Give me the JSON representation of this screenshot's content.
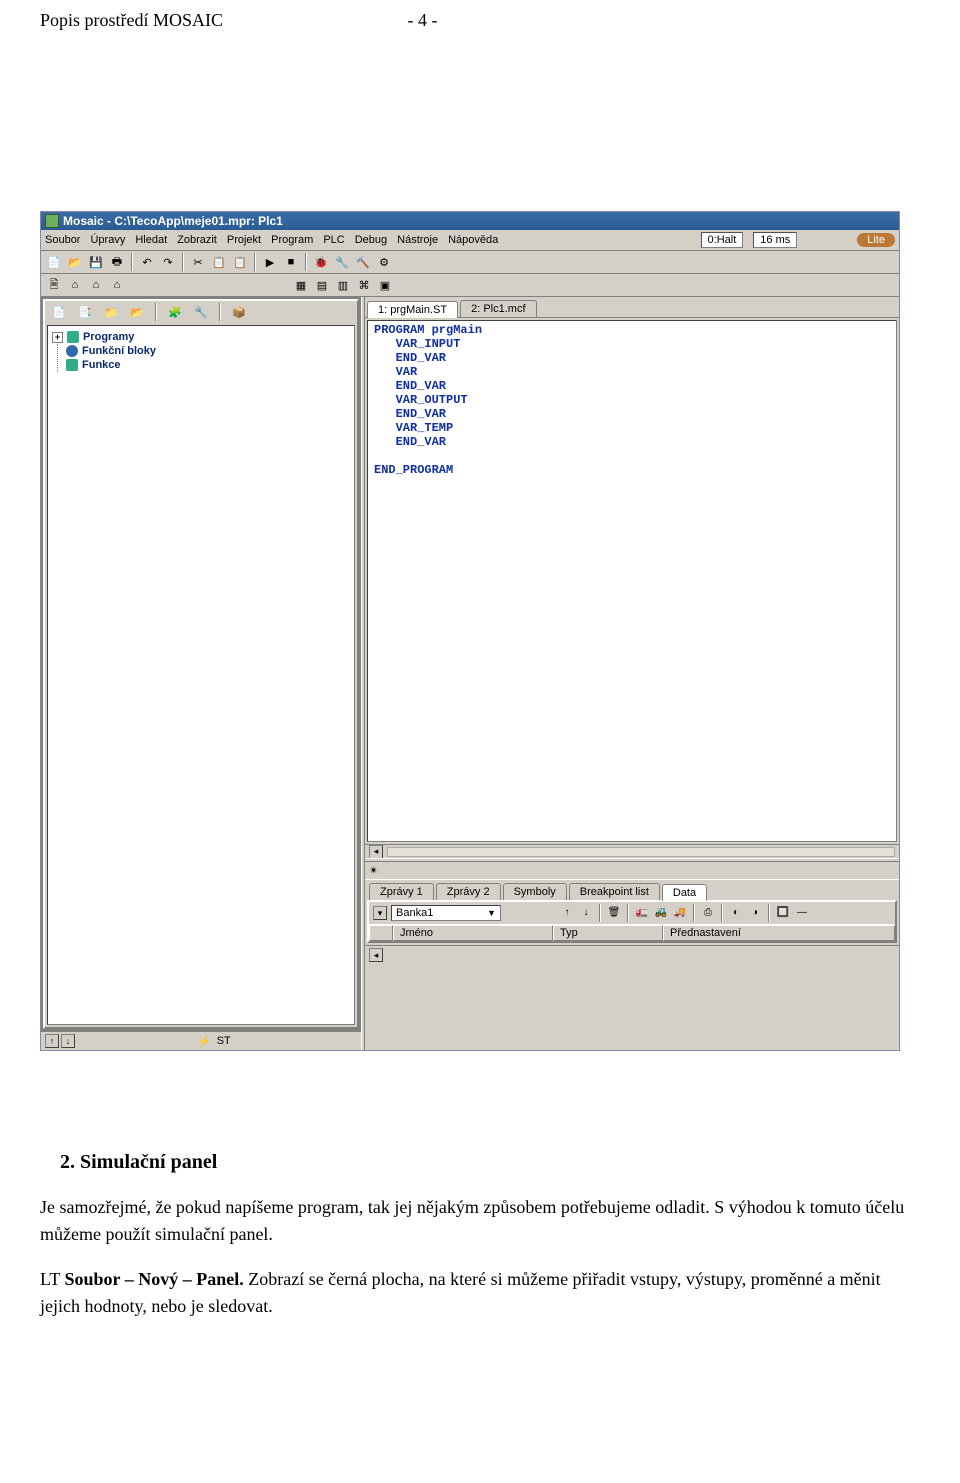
{
  "doc": {
    "header_left": "Popis prostředí MOSAIC",
    "header_right": "- 4 -",
    "heading": "2.  Simulační panel",
    "para1": "Je samozřejmé, že pokud napíšeme program, tak jej nějakým způsobem potřebujeme odladit. S výhodou k tomuto účelu můžeme použít simulační panel.",
    "para2_prefix": "LT ",
    "para2_bold": "Soubor – Nový – Panel.",
    "para2_rest": " Zobrazí se černá plocha, na které si můžeme přiřadit vstupy, výstupy, proměnné a měnit jejich hodnoty, nebo je sledovat."
  },
  "app": {
    "title": "Mosaic - C:\\TecoApp\\meje01.mpr: Plc1",
    "menu": [
      "Soubor",
      "Úpravy",
      "Hledat",
      "Zobrazit",
      "Projekt",
      "Program",
      "PLC",
      "Debug",
      "Nástroje",
      "Nápověda"
    ],
    "status1": "0:Halt",
    "status2": "16 ms",
    "status3": "Lite",
    "toolbar1": [
      "📄",
      "📂",
      "💾",
      "🖶",
      "",
      "↶",
      "↷",
      "",
      "✂",
      "📋",
      "📋",
      "",
      "▶",
      "■",
      "",
      "🐞",
      "🔧",
      "🔨",
      "⚙"
    ],
    "toolbar2_left": [
      "🗎",
      "⌂",
      "⌂",
      "⌂"
    ],
    "toolbar2_right": [
      "▦",
      "▤",
      "▥",
      "⌘",
      "▣"
    ],
    "tree_toolbar": [
      "📄",
      "📑",
      "📁",
      "📂",
      "",
      "🧩",
      "🔧",
      "",
      "📦"
    ],
    "tree": {
      "items": [
        {
          "expander": "+",
          "icon": "green",
          "label": "Programy"
        },
        {
          "expander": "",
          "icon": "blue",
          "label": "Funkční bloky",
          "indent": 1
        },
        {
          "expander": "",
          "icon": "green",
          "label": "Funkce",
          "indent": 1
        }
      ]
    },
    "left_bottom_label": "ST",
    "editor_tabs": [
      "1: prgMain.ST",
      "2: Plc1.mcf"
    ],
    "editor_active_tab": 0,
    "code_lines": [
      "PROGRAM prgMain",
      "   VAR_INPUT",
      "   END_VAR",
      "   VAR",
      "   END_VAR",
      "   VAR_OUTPUT",
      "   END_VAR",
      "   VAR_TEMP",
      "   END_VAR",
      "",
      "END_PROGRAM"
    ],
    "bottom_tabs": [
      "Zprávy 1",
      "Zprávy 2",
      "Symboly",
      "Breakpoint list",
      "Data"
    ],
    "bottom_active_tab": 4,
    "bottom_combo": "Banka1",
    "bottom_icons": [
      "↑",
      "↓",
      "",
      "🗑",
      "",
      "🚛",
      "🚜",
      "🚚",
      "",
      "⎙",
      "",
      "◐",
      "◑",
      "",
      "🔲",
      "—"
    ],
    "data_headers": [
      "",
      "Jméno",
      "Typ",
      "Přednastavení"
    ]
  }
}
